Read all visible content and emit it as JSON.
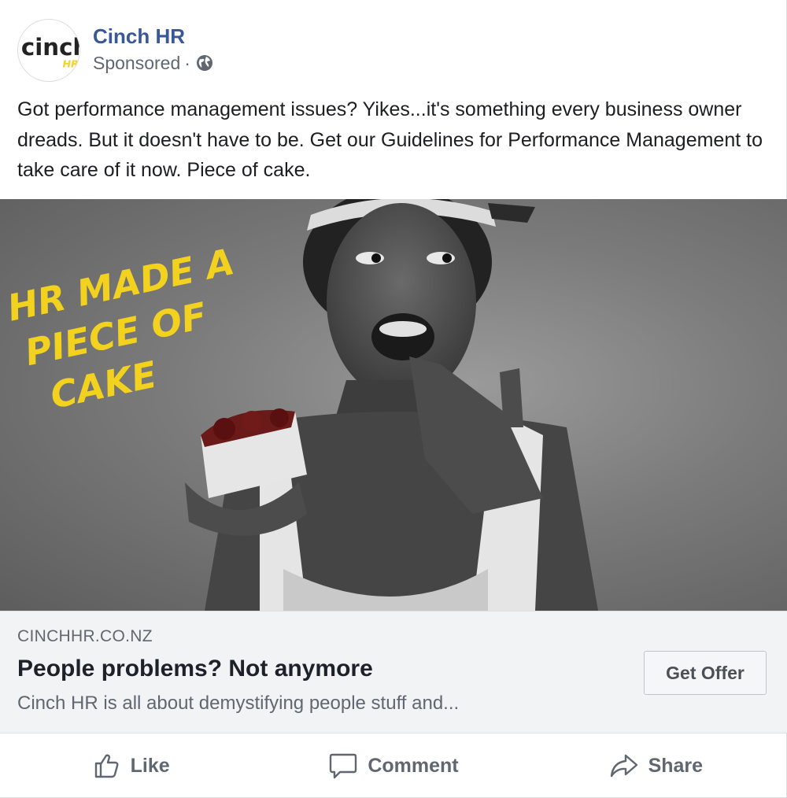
{
  "post": {
    "page_name": "Cinch HR",
    "sponsored_label": "Sponsored",
    "separator": "·",
    "privacy_icon": "globe-icon",
    "text": "Got performance management issues? Yikes...it's something every business owner dreads. But it doesn't have to be. Get our Guidelines for Performance Management to take care of it now. Piece of cake."
  },
  "avatar": {
    "logo_text": "cinch",
    "logo_sub": "HR",
    "accent_color": "#f3d22b"
  },
  "hero_image": {
    "overlay_lines": [
      "HR MADE A",
      "PIECE OF",
      "CAKE"
    ],
    "overlay_color": "#f2d21e"
  },
  "link_preview": {
    "domain": "CINCHHR.CO.NZ",
    "headline": "People problems? Not anymore",
    "description": "Cinch HR is all about demystifying people stuff and...",
    "cta_label": "Get Offer"
  },
  "actions": {
    "like": {
      "label": "Like",
      "icon": "thumbs-up-icon"
    },
    "comment": {
      "label": "Comment",
      "icon": "comment-bubble-icon"
    },
    "share": {
      "label": "Share",
      "icon": "share-arrow-icon"
    }
  },
  "colors": {
    "page_name": "#385898",
    "muted": "#606770",
    "link_bg": "#f2f3f5"
  }
}
